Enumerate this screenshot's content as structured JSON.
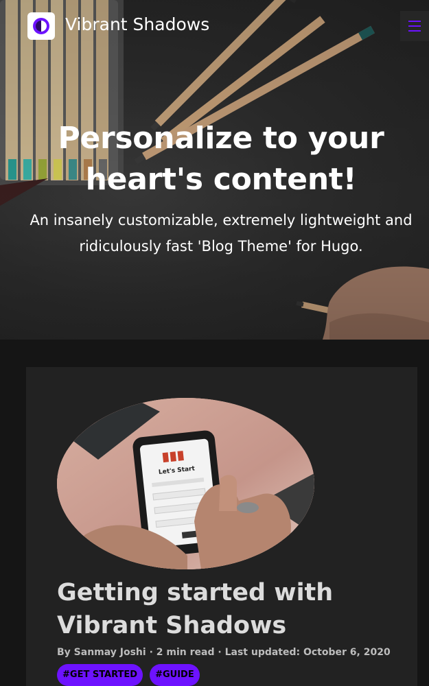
{
  "header": {
    "site_title": "Vibrant Shadows",
    "logo_icon": "half-moon-icon",
    "menu_icon": "hamburger-menu-icon",
    "accent": "#6d12ff"
  },
  "hero": {
    "title": "Personalize to your heart's content!",
    "subtitle": "An insanely customizable, extremely lightweight and ridiculously fast 'Blog Theme' for Hugo."
  },
  "post": {
    "image": "phone-in-hand-photo",
    "title": "Getting started with Vibrant Shadows",
    "meta": {
      "author": "By Sanmay Joshi",
      "separator_1": " · ",
      "read_time": "2 min read",
      "separator_2": " · ",
      "updated": "Last updated: October 6, 2020"
    },
    "tags": [
      "#GET STARTED",
      "#GUIDE"
    ],
    "phone_screen_text": "Let's Start"
  }
}
